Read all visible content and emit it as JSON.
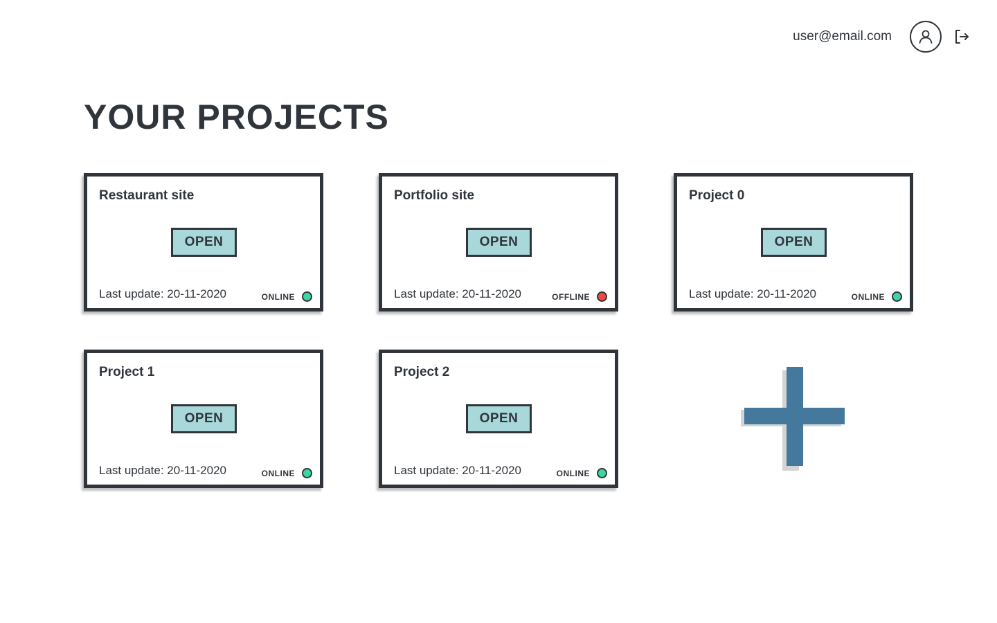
{
  "header": {
    "user_email": "user@email.com",
    "avatar_icon": "user-icon",
    "logout_icon": "logout-icon"
  },
  "page": {
    "title": "YOUR PROJECTS"
  },
  "colors": {
    "dark": "#30353b",
    "button_bg": "#a8d8da",
    "online": "#3ed6a0",
    "offline": "#ef4a3c",
    "add_accent": "#44789c"
  },
  "projects": [
    {
      "title": "Restaurant site",
      "open_label": "OPEN",
      "last_update": "Last update: 20-11-2020",
      "status": "ONLINE",
      "status_color": "#3ed6a0"
    },
    {
      "title": "Portfolio site",
      "open_label": "OPEN",
      "last_update": "Last update: 20-11-2020",
      "status": "OFFLINE",
      "status_color": "#ef4a3c"
    },
    {
      "title": "Project 0",
      "open_label": "OPEN",
      "last_update": "Last update: 20-11-2020",
      "status": "ONLINE",
      "status_color": "#3ed6a0"
    },
    {
      "title": "Project 1",
      "open_label": "OPEN",
      "last_update": "Last update: 20-11-2020",
      "status": "ONLINE",
      "status_color": "#3ed6a0"
    },
    {
      "title": "Project 2",
      "open_label": "OPEN",
      "last_update": "Last update: 20-11-2020",
      "status": "ONLINE",
      "status_color": "#3ed6a0"
    }
  ],
  "add_project": {
    "icon": "plus-icon"
  }
}
